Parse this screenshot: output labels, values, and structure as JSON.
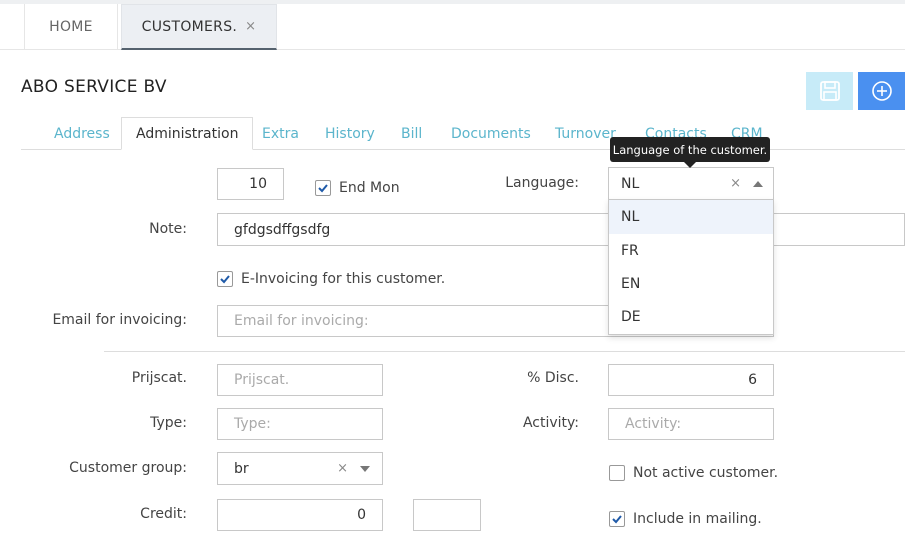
{
  "app_tabs": [
    {
      "label": "HOME"
    },
    {
      "label": "CUSTOMERS.",
      "close": "×"
    }
  ],
  "customer_name": "ABO SERVICE BV",
  "sub_tabs": [
    {
      "label": "Address"
    },
    {
      "label": "Administration"
    },
    {
      "label": "Extra"
    },
    {
      "label": "History"
    },
    {
      "label": "Bill"
    },
    {
      "label": "Documents"
    },
    {
      "label": "Turnover"
    },
    {
      "label": "Contacts"
    },
    {
      "label": "CRM"
    }
  ],
  "active_sub_tab": "Administration",
  "form": {
    "days_value": "10",
    "end_mon_label": "End Mon",
    "end_mon_checked": true,
    "language_label": "Language:",
    "language_value": "NL",
    "language_clear": "×",
    "language_options": [
      "NL",
      "FR",
      "EN",
      "DE"
    ],
    "language_tooltip": "Language of the customer.",
    "note_label": "Note:",
    "note_value": "gfdgsdffgsdfg",
    "einvoicing_label": "E-Invoicing for this customer.",
    "einvoicing_checked": true,
    "email_label": "Email for invoicing:",
    "email_placeholder": "Email for invoicing:",
    "prijscat_label": "Prijscat.",
    "prijscat_placeholder": "Prijscat.",
    "disc_label": "% Disc.",
    "disc_value": "6",
    "type_label": "Type:",
    "type_placeholder": "Type:",
    "activity_label": "Activity:",
    "activity_placeholder": "Activity:",
    "group_label": "Customer group:",
    "group_value": "br",
    "group_clear": "×",
    "not_active_label": "Not active customer.",
    "not_active_checked": false,
    "credit_label": "Credit:",
    "credit_value": "0",
    "credit_extra_value": "",
    "mailing_label": "Include in mailing.",
    "mailing_checked": true
  },
  "colors": {
    "tab_link": "#5bb5cc",
    "save_button": "#c7ebf8",
    "add_button": "#4a90f0",
    "checkbox_check": "#1f5aa8",
    "tooltip_bg": "#222222"
  },
  "icons": {
    "save": "save-icon",
    "add": "plus-circle-icon"
  }
}
